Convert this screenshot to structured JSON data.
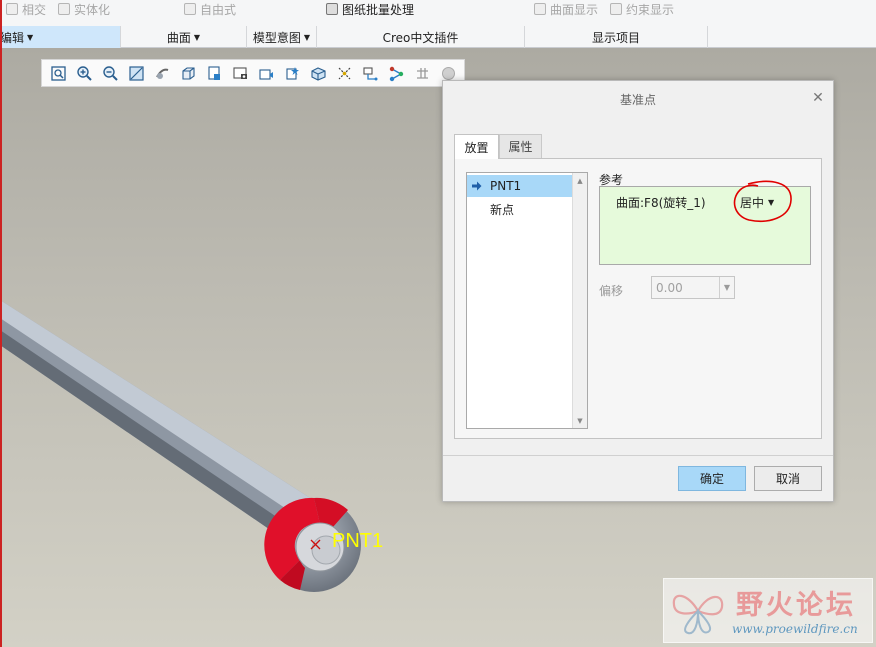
{
  "ribbon": {
    "top_items": [
      {
        "label": "相交",
        "icon": "intersect-icon"
      },
      {
        "label": "实体化",
        "icon": "solidify-icon"
      },
      {
        "label": "自由式",
        "icon": "freestyle-icon"
      },
      {
        "label": "图纸批量处理",
        "icon": "batch-drawing-icon"
      },
      {
        "label": "曲面显示",
        "icon": "surface-display-icon"
      },
      {
        "label": "约束显示",
        "icon": "constraint-display-icon"
      }
    ],
    "groups": [
      {
        "label": "编辑",
        "dropdown": true
      },
      {
        "label": "曲面",
        "dropdown": true
      },
      {
        "label": "模型意图",
        "dropdown": true
      },
      {
        "label": "Creo中文插件",
        "dropdown": false
      },
      {
        "label": "显示项目",
        "dropdown": false
      }
    ]
  },
  "graphics_toolbar": [
    "refit-icon",
    "zoom-in-icon",
    "zoom-out-icon",
    "repaint-icon",
    "spin-center-icon",
    "display-style-icon",
    "saved-orientations-icon",
    "view-manager-icon",
    "perspective-icon",
    "section-icon",
    "appearance-icon",
    "datum-display-icon",
    "annotation-display-icon",
    "network-icon",
    "ruler-icon",
    "sphere-icon"
  ],
  "model": {
    "point_label": "PNT1"
  },
  "dialog": {
    "title": "基准点",
    "tabs": {
      "placement": "放置",
      "properties": "属性"
    },
    "points": [
      "PNT1",
      "新点"
    ],
    "references_label": "参考",
    "reference": {
      "text": "曲面:F8(旋转_1)",
      "constraint": "居中"
    },
    "offset": {
      "label": "偏移",
      "value": "0.00"
    },
    "ok_label": "确定",
    "cancel_label": "取消"
  },
  "watermark": {
    "title": "野火论坛",
    "url": "www.proewildfire.cn"
  },
  "colors": {
    "selection": "#a8d8f8",
    "reference_bg": "#e6fadb",
    "point_label": "#ffff00",
    "annotation": "#e00000"
  }
}
